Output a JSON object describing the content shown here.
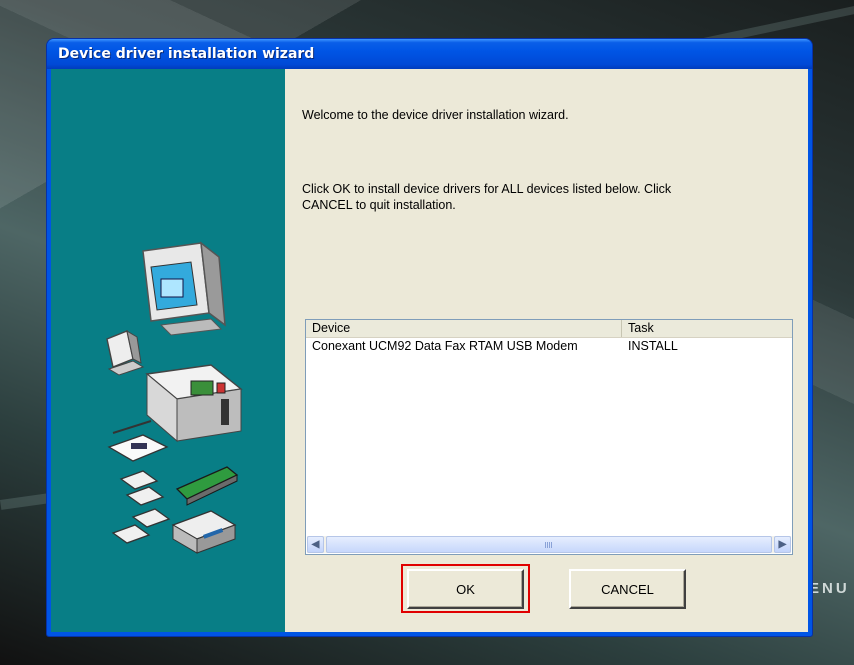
{
  "window": {
    "title": "Device driver installation wizard"
  },
  "content": {
    "welcome_text": "Welcome to the device driver installation wizard.",
    "instruction_line1": "Click OK to install device drivers for ALL devices listed below. Click",
    "instruction_line2": "CANCEL to quit installation."
  },
  "device_list": {
    "columns": [
      "Device",
      "Task"
    ],
    "rows": [
      {
        "device": "Conexant UCM92 Data Fax RTAM USB Modem",
        "task": "INSTALL"
      }
    ]
  },
  "buttons": {
    "ok_label": "OK",
    "cancel_label": "CANCEL"
  },
  "desktop": {
    "partial_text": "ENU"
  },
  "colors": {
    "accent_highlight": "#e00000",
    "left_panel": "#087e86",
    "title_bar": "#0055e5"
  }
}
